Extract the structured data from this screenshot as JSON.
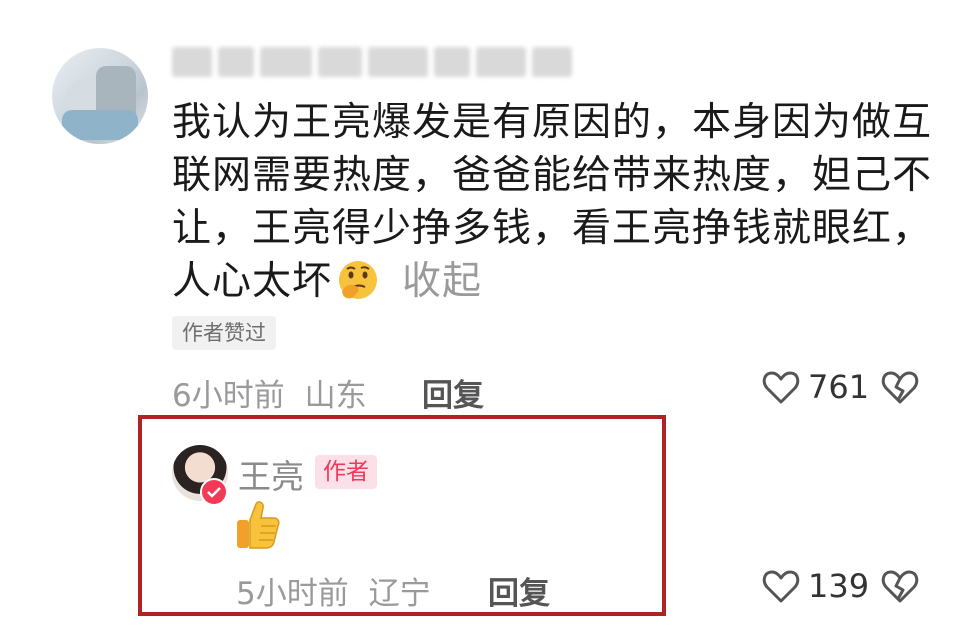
{
  "comment": {
    "text": "我认为王亮爆发是有原因的，本身因为做互联网需要热度，爸爸能给带来热度，妲己不让，王亮得少挣多钱，看王亮挣钱就眼红，人心太坏",
    "emoji": "thinking-face-emoji",
    "collapse_label": "收起",
    "author_liked_tag": "作者赞过",
    "time": "6小时前",
    "location": "山东",
    "reply_label": "回复",
    "like_count": "761"
  },
  "reply": {
    "username": "王亮",
    "author_tag": "作者",
    "emoji": "thumbs-up-emoji",
    "time": "5小时前",
    "location": "辽宁",
    "reply_label": "回复",
    "like_count": "139"
  },
  "colors": {
    "highlight_border": "#b12222",
    "author_tag_text": "#f0385b",
    "author_tag_bg": "#fbe1e7",
    "meta_text": "#9a9a9a"
  }
}
